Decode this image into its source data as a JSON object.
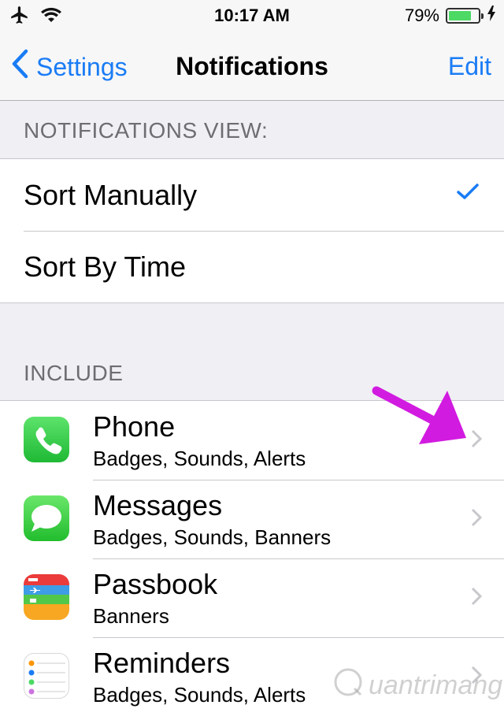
{
  "status_bar": {
    "time": "10:17 AM",
    "battery_text": "79%",
    "battery_level": 0.79,
    "battery_color": "#4cd964"
  },
  "nav": {
    "back_label": "Settings",
    "title": "Notifications",
    "edit_label": "Edit",
    "accent": "#1a7cf5"
  },
  "view_section": {
    "header": "NOTIFICATIONS VIEW:",
    "options": [
      {
        "label": "Sort Manually",
        "selected": true
      },
      {
        "label": "Sort By Time",
        "selected": false
      }
    ]
  },
  "include_section": {
    "header": "INCLUDE",
    "apps": [
      {
        "name": "Phone",
        "detail": "Badges, Sounds, Alerts",
        "icon": "phone-icon"
      },
      {
        "name": "Messages",
        "detail": "Badges, Sounds, Banners",
        "icon": "messages-icon"
      },
      {
        "name": "Passbook",
        "detail": "Banners",
        "icon": "passbook-icon"
      },
      {
        "name": "Reminders",
        "detail": "Badges, Sounds, Alerts",
        "icon": "reminders-icon"
      }
    ]
  },
  "annotation": {
    "color": "#d21be0"
  },
  "watermark": {
    "text": "uantrimang"
  }
}
